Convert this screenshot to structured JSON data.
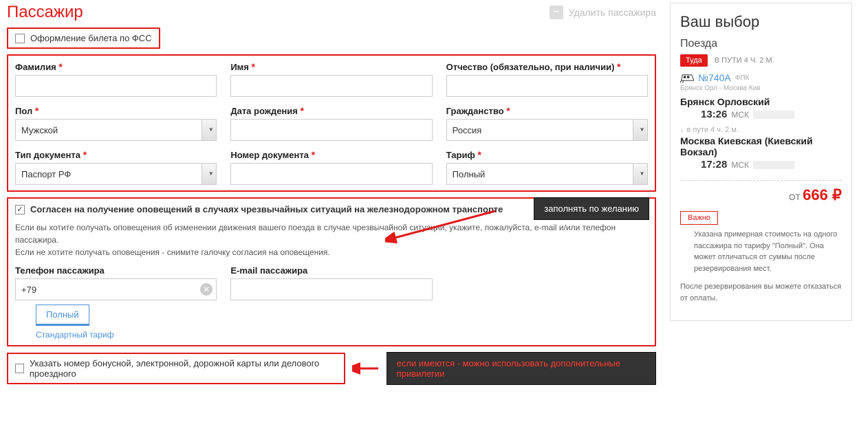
{
  "header": {
    "title": "Пассажир",
    "delete_label": "Удалить пассажира"
  },
  "fss": {
    "label": "Оформление билета по ФСС"
  },
  "form": {
    "surname_label": "Фамилия",
    "name_label": "Имя",
    "patronymic_label": "Отчество (обязательно, при наличии)",
    "gender_label": "Пол",
    "gender_value": "Мужской",
    "dob_label": "Дата рождения",
    "citizenship_label": "Гражданство",
    "citizenship_value": "Россия",
    "doctype_label": "Тип документа",
    "doctype_value": "Паспорт РФ",
    "docnum_label": "Номер документа",
    "tariff_label": "Тариф",
    "tariff_value": "Полный"
  },
  "notify": {
    "consent_label": "Согласен на получение оповещений в случаях чрезвычайных ситуаций на железнодорожном транспорте",
    "hint1": "Если вы хотите получать оповещения об изменении движения вашего поезда в случае чрезвычайной ситуации, укажите, пожалуйста, e-mail и/или телефон пассажира.",
    "hint2": "Если не хотите получать оповещения - снимите галочку согласия на оповещения.",
    "phone_label": "Телефон пассажира",
    "phone_value": "+79",
    "email_label": "E-mail пассажира",
    "tariff_tag": "Полный",
    "tariff_link": "Стандартный тариф"
  },
  "bonus": {
    "label": "Указать номер бонусной, электронной, дорожной карты или делового проездного"
  },
  "callouts": {
    "optional": "заполнять по желанию",
    "bonus_hint": "если имеются - можно использовать дополнительные привилегии"
  },
  "sidebar": {
    "title": "Ваш выбор",
    "subtitle": "Поезда",
    "direction_badge": "Туда",
    "travel_time": "В ПУТИ 4 Ч. 2 М.",
    "train_number": "№740А",
    "carrier": "ФПК",
    "route_small": "Брянск Орл - Москва Кив",
    "dep_station": "Брянск Орловский",
    "dep_time": "13:26",
    "tz": "МСК",
    "transit": "в пути  4 ч. 2 м.",
    "arr_station": "Москва Киевская (Киевский Вокзал)",
    "arr_time": "17:28",
    "price_prefix": "ОТ",
    "price": "666 ₽",
    "important": "Важно",
    "note1": "Указана примерная стоимость на одного пассажира по тарифу \"Полный\". Она может отличаться от суммы после резервирования мест.",
    "note2": "После резервирования вы можете отказаться от оплаты."
  }
}
